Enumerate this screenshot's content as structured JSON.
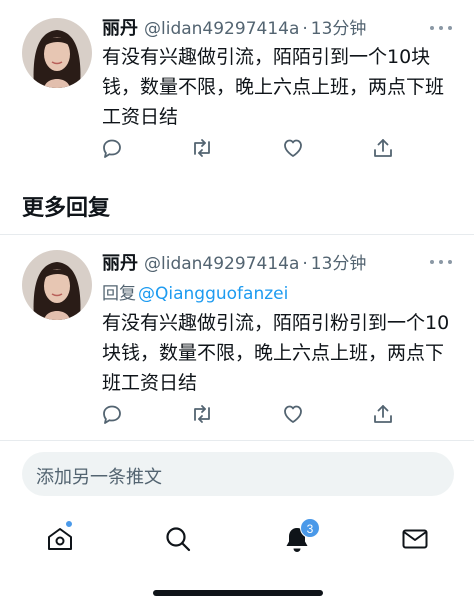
{
  "colors": {
    "accent": "#1d9bf0",
    "text_secondary": "#536471",
    "badge": "#4a99e9",
    "compose_bg": "#eff3f4"
  },
  "tweets": [
    {
      "name": "丽丹",
      "handle": "@lidan49297414a",
      "separator": "·",
      "time": "13分钟",
      "body": "有没有兴趣做引流，陌陌引到一个10块钱，数量不限，晚上六点上班，两点下班工资日结",
      "actions": [
        "reply-icon",
        "retweet-icon",
        "like-icon",
        "share-icon"
      ]
    },
    {
      "name": "丽丹",
      "handle": "@lidan49297414a",
      "separator": "·",
      "time": "13分钟",
      "reply_label": "回复",
      "reply_to": "@Qiangguofanzei",
      "body": "有没有兴趣做引流，陌陌引粉引到一个10块钱，数量不限，晚上六点上班，两点下班工资日结",
      "actions": [
        "reply-icon",
        "retweet-icon",
        "like-icon",
        "share-icon"
      ]
    }
  ],
  "section_title": "更多回复",
  "compose": {
    "placeholder": "添加另一条推文"
  },
  "tabbar": {
    "items": [
      "home-icon",
      "search-icon",
      "notifications-icon",
      "messages-icon"
    ],
    "notification_count": "3"
  }
}
